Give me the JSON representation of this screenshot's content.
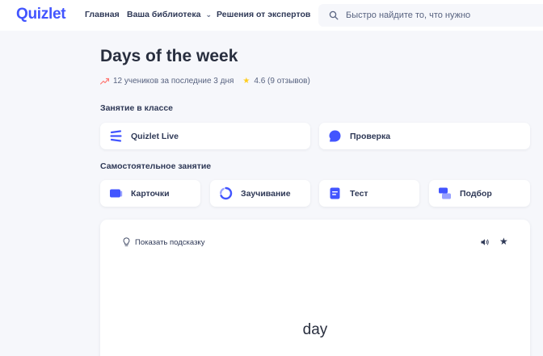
{
  "header": {
    "logo": "Quizlet",
    "nav": {
      "home": "Главная",
      "library": "Ваша библиотека",
      "experts": "Решения от экспертов"
    },
    "search": {
      "placeholder": "Быстро найдите то, что нужно",
      "value": ""
    }
  },
  "set": {
    "title": "Days of the week",
    "learners": "12 учеников за последние 3 дня",
    "rating": "4.6 (9 отзывов)"
  },
  "sections": {
    "classroom": {
      "heading": "Занятие в классе",
      "modes": [
        "Quizlet Live",
        "Проверка"
      ]
    },
    "self_study": {
      "heading": "Самостоятельное занятие",
      "modes": [
        "Карточки",
        "Заучивание",
        "Тест",
        "Подбор"
      ]
    }
  },
  "flashcard": {
    "hint_label": "Показать подсказку",
    "term": "day"
  },
  "colors": {
    "brand": "#4255ff",
    "live": "#4255ff",
    "check": "#4255ff",
    "flashcards": "#4255ff",
    "learn": "#4255ff",
    "test": "#4255ff",
    "match": "#4255ff",
    "star": "#ffcd1f",
    "trend": "#ff7873"
  },
  "icons": {
    "search": "search-icon",
    "trend": "trending-up-icon",
    "star": "star-icon",
    "live": "quizlet-live-icon",
    "check": "check-bubble-icon",
    "flashcards": "flashcards-icon",
    "learn": "learn-cycle-icon",
    "test": "test-icon",
    "match": "match-icon",
    "hint": "lightbulb-icon",
    "sound": "sound-icon",
    "favorite": "star-outline-icon"
  }
}
